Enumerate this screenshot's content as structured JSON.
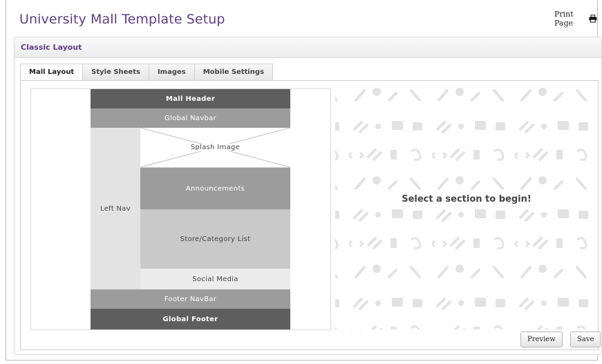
{
  "header": {
    "title": "University Mall Template Setup",
    "print_label": "Print Page",
    "print_icon": "printer-icon"
  },
  "panel": {
    "title": "Classic Layout"
  },
  "tabs": [
    {
      "label": "Mall Layout",
      "active": true
    },
    {
      "label": "Style Sheets",
      "active": false
    },
    {
      "label": "Images",
      "active": false
    },
    {
      "label": "Mobile Settings",
      "active": false
    }
  ],
  "layout": {
    "mall_header": "Mall Header",
    "global_navbar": "Global Navbar",
    "left_nav": "Left Nav",
    "splash_image": "Splash Image",
    "announcements": "Announcements",
    "store_category_list": "Store/Category List",
    "social_media": "Social Media",
    "footer_navbar": "Footer NavBar",
    "global_footer": "Global Footer"
  },
  "editor": {
    "empty_message": "Select a section to begin!"
  },
  "buttons": {
    "preview": "Preview",
    "save": "Save"
  },
  "colors": {
    "title": "#5b3f86",
    "dark_section": "#5e5e5e",
    "mid_section": "#9c9c9c",
    "light_section": "#c9c9c9",
    "pattern": "#e4e4e4"
  }
}
